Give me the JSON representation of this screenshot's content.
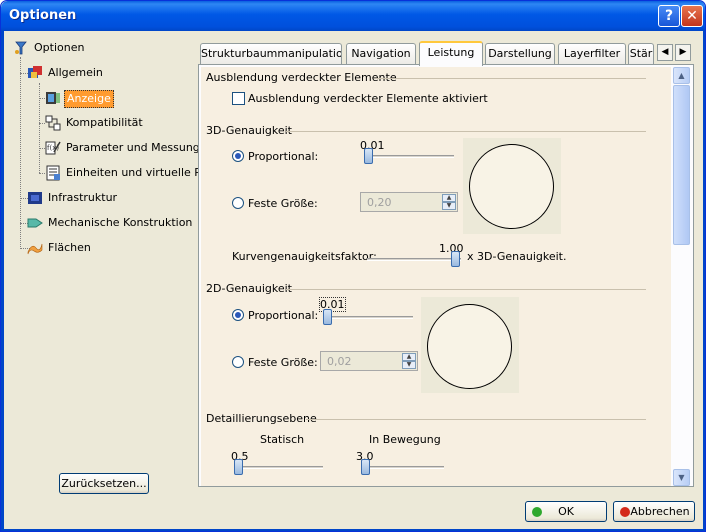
{
  "window": {
    "title": "Optionen",
    "help_icon": "?",
    "close_icon": "✕"
  },
  "tree": {
    "root": "Optionen",
    "items": [
      {
        "label": "Allgemein"
      },
      {
        "label": "Anzeige"
      },
      {
        "label": "Kompatibilität"
      },
      {
        "label": "Parameter und Messungen"
      },
      {
        "label": "Einheiten und virtuelle Realit"
      },
      {
        "label": "Infrastruktur"
      },
      {
        "label": "Mechanische Konstruktion"
      },
      {
        "label": "Flächen"
      }
    ]
  },
  "reset_button": "Zurücksetzen...",
  "tabs": [
    {
      "label": "Strukturbaummanipulation"
    },
    {
      "label": "Navigation"
    },
    {
      "label": "Leistung"
    },
    {
      "label": "Darstellung"
    },
    {
      "label": "Layerfilter"
    },
    {
      "label": "Stär"
    }
  ],
  "tab_scroll": {
    "left": "◀",
    "right": "▶"
  },
  "content": {
    "hidden": {
      "title": "Ausblendung verdeckter Elemente",
      "checkbox_label": "Ausblendung verdeckter Elemente aktiviert",
      "checked": false
    },
    "acc3d": {
      "title": "3D-Genauigkeit",
      "proportional_label": "Proportional:",
      "proportional_selected": true,
      "proportional_value": "0.01",
      "fixed_label": "Feste Größe:",
      "fixed_value": "0,20",
      "curve_label": "Kurvengenauigkeitsfaktor:",
      "curve_value": "1.00",
      "curve_suffix": "x 3D-Genauigkeit."
    },
    "acc2d": {
      "title": "2D-Genauigkeit",
      "proportional_label": "Proportional:",
      "proportional_selected": true,
      "proportional_value": "0.01",
      "fixed_label": "Feste Größe:",
      "fixed_value": "0,02"
    },
    "detail": {
      "title": "Detaillierungsebene",
      "static_label": "Statisch",
      "static_value": "0.5",
      "moving_label": "In Bewegung",
      "moving_value": "3.0"
    }
  },
  "buttons": {
    "ok": "OK",
    "cancel": "Abbrechen"
  },
  "colors": {
    "selection": "#ff9b2f",
    "titlebar": "#0058e6",
    "ok_dot": "#2ea82e",
    "cancel_dot": "#d42a1a"
  }
}
